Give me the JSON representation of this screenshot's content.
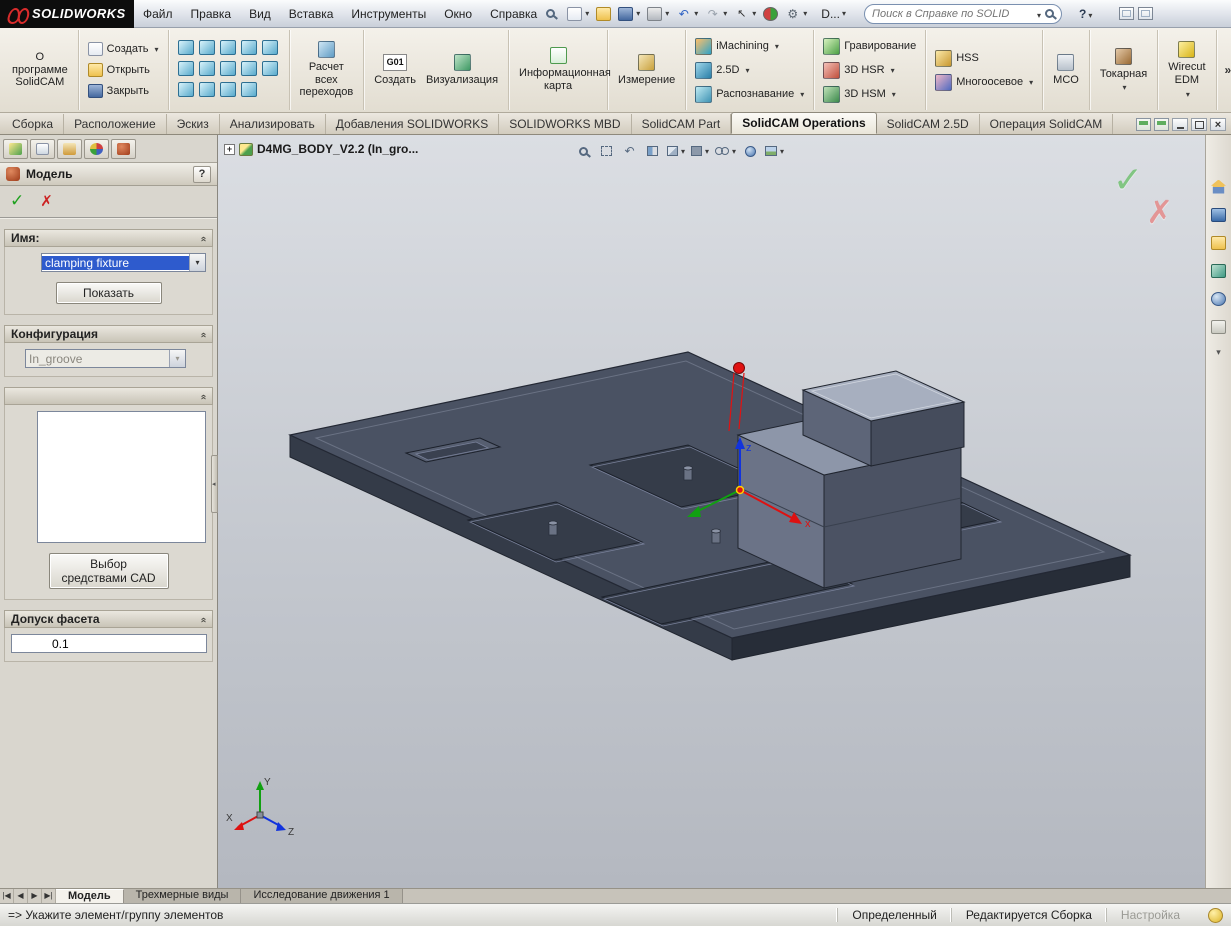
{
  "titlebar": {
    "logo_text": "SOLIDWORKS",
    "menus": [
      "Файл",
      "Правка",
      "Вид",
      "Вставка",
      "Инструменты",
      "Окно",
      "Справка"
    ],
    "doc_switcher": "D...",
    "search_placeholder": "Поиск в Справке по SOLID",
    "help_label": "?"
  },
  "ribbon": {
    "about": "О программе SolidCAM",
    "create": "Создать",
    "open": "Открыть",
    "close": "Закрыть",
    "calc": "Расчет всех переходов",
    "g01": "G01",
    "g01_sub": "Создать",
    "visualization": "Визуализация",
    "infocard": "Информационная карта",
    "measure": "Измерение",
    "imachining": "iMachining",
    "d25": "2.5D",
    "recognize": "Распознавание",
    "engrave": "Гравирование",
    "hsr": "3D HSR",
    "hsm": "3D HSM",
    "hss": "HSS",
    "multiax": "Многоосевое",
    "mco": "MCO",
    "turning": "Токарная",
    "wirecut": "Wirecut EDM",
    "overflow": "»"
  },
  "tabs": [
    "Сборка",
    "Расположение",
    "Эскиз",
    "Анализировать",
    "Добавления SOLIDWORKS",
    "SOLIDWORKS MBD",
    "SolidCAM Part",
    "SolidCAM Operations",
    "SolidCAM 2.5D",
    "Операция SolidCAM"
  ],
  "panel": {
    "title": "Модель",
    "help": "?",
    "group_name": "Имя:",
    "name_value": "clamping fixture",
    "show_button": "Показать",
    "group_config": "Конфигурация",
    "config_value": "In_groove",
    "cad_button": "Выбор средствами CAD",
    "group_tolerance": "Допуск фасета",
    "tolerance_value": "0.1"
  },
  "viewport": {
    "tree_label": "D4MG_BODY_V2.2  (In_gro...",
    "axis_z": "z",
    "axis_x": "x",
    "ref_x": "X",
    "ref_y": "Y",
    "ref_z": "Z"
  },
  "bottom_tabs": [
    "Модель",
    "Трехмерные виды",
    "Исследование движения 1"
  ],
  "statusbar": {
    "prompt": "=> Укажите элемент/группу элементов",
    "state": "Определенный",
    "mode": "Редактируется Сборка",
    "customize": "Настройка"
  },
  "colors": {
    "selection_blue": "#2e5bcd",
    "ok_green": "#1fa11f",
    "cancel_red": "#cc2222",
    "axis_x_red": "#dd1111",
    "axis_y_green": "#11a011",
    "axis_z_blue": "#1133dd",
    "plate_fill": "#4a5263",
    "block_top": "#a7afbf"
  }
}
